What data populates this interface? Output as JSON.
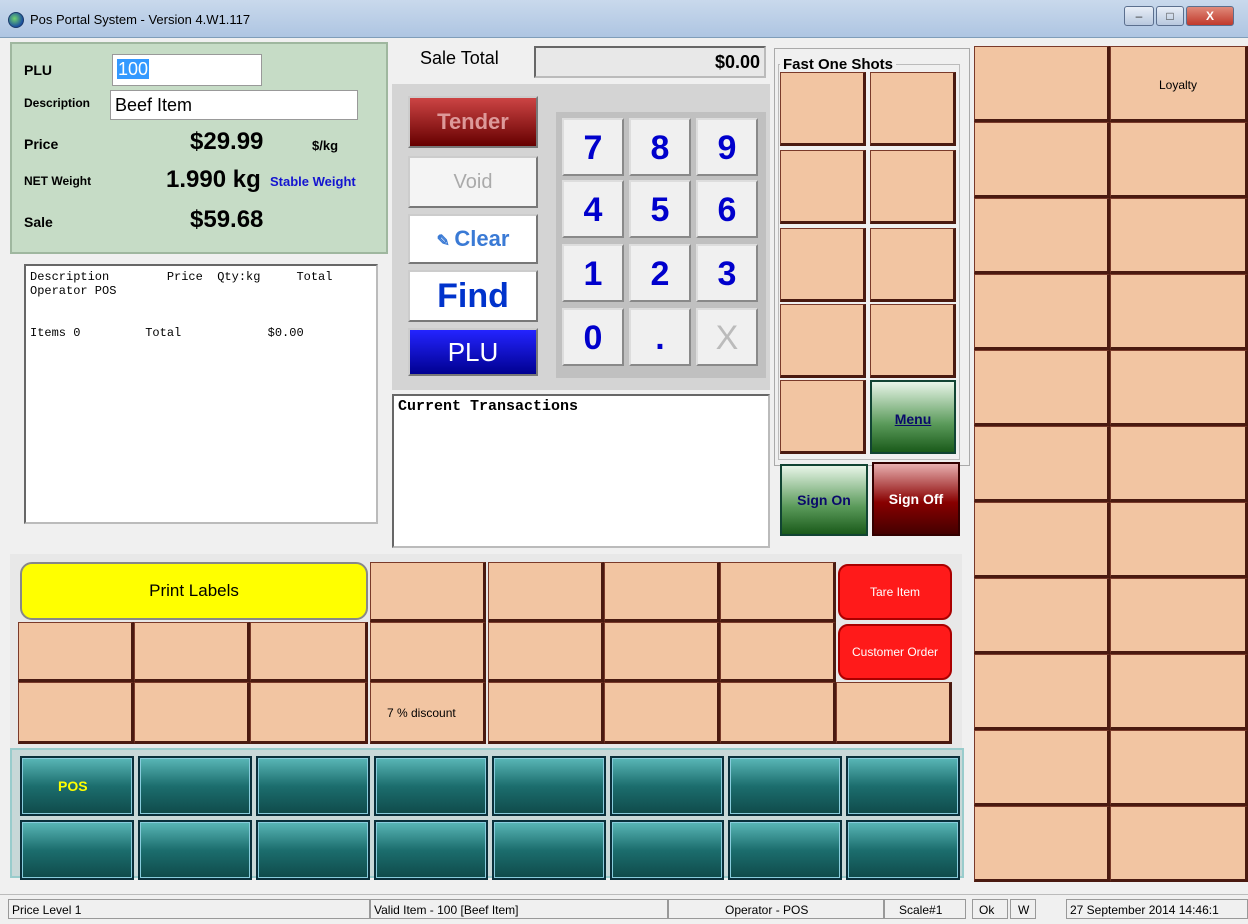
{
  "window": {
    "title": "Pos Portal System - Version  4.W1.117",
    "min": "–",
    "max": "□",
    "close": "X"
  },
  "info": {
    "plu_label": "PLU",
    "plu_value": "100",
    "desc_label": "Description",
    "desc_value": "Beef Item",
    "price_label": "Price",
    "price_value": "$29.99",
    "price_unit": "$/kg",
    "weight_label": "NET Weight",
    "weight_value": "1.990 kg",
    "weight_status": "Stable Weight",
    "sale_label": "Sale",
    "sale_value": "$59.68"
  },
  "receipt": {
    "text": "Description        Price  Qty:kg     Total\nOperator POS\n\n\nItems 0         Total            $0.00"
  },
  "sale_total": {
    "label": "Sale Total",
    "value": "$0.00"
  },
  "actions": {
    "tender": "Tender",
    "void": "Void",
    "clear": "Clear",
    "find": "Find",
    "plu": "PLU"
  },
  "numpad": [
    "7",
    "8",
    "9",
    "4",
    "5",
    "6",
    "1",
    "2",
    "3",
    "0",
    ".",
    "X"
  ],
  "current_transactions": "Current Transactions",
  "fast_one_shots": {
    "title": "Fast One Shots",
    "menu": "Menu"
  },
  "sign": {
    "on": "Sign On",
    "off": "Sign Off"
  },
  "grid": {
    "print_labels": "Print Labels",
    "tare_item": "Tare Item",
    "customer_order": "Customer Order",
    "discount": "7 % discount"
  },
  "tabs": {
    "pos": "POS"
  },
  "right": {
    "loyalty": "Loyalty"
  },
  "status": {
    "price_level": "Price Level 1",
    "valid_item": "Valid Item - 100 [Beef Item]",
    "operator": "Operator - POS",
    "scale": "Scale#1",
    "ok": "Ok",
    "w": "W",
    "datetime": "27 September 2014 14:46:1"
  }
}
